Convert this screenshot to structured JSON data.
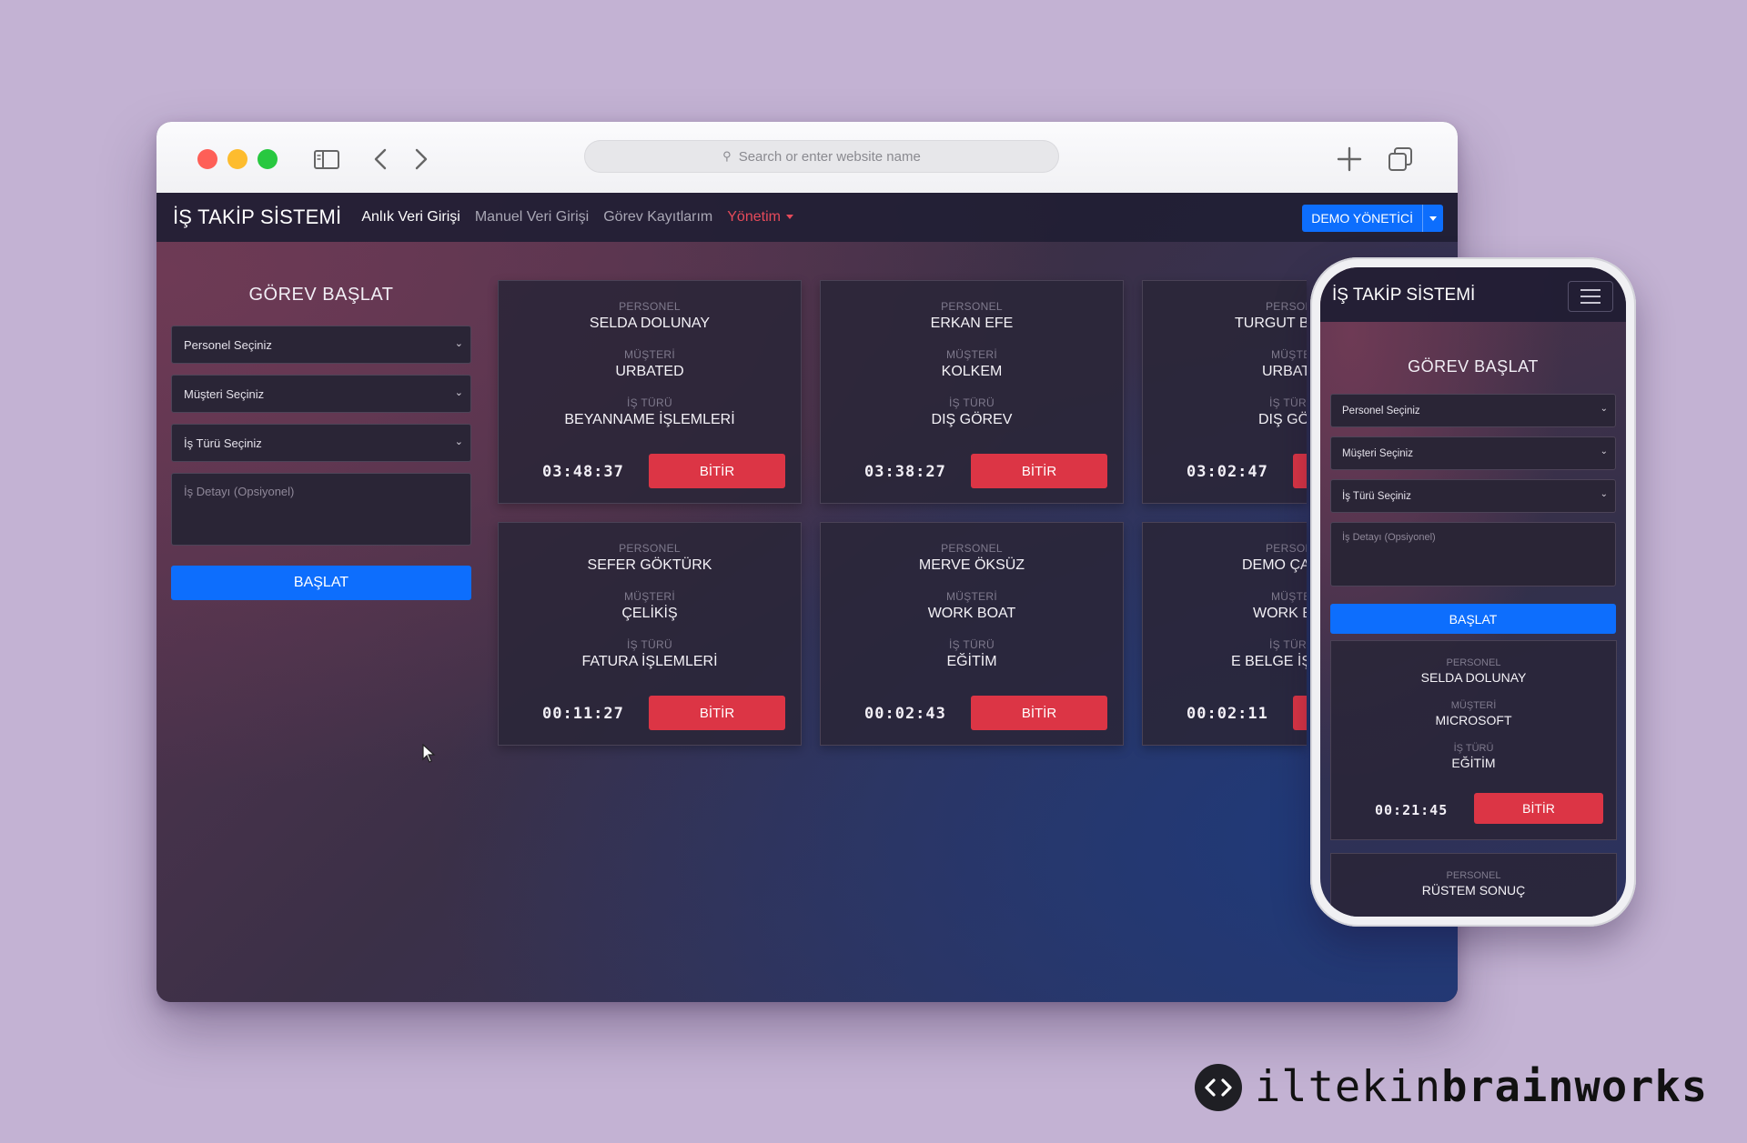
{
  "browser": {
    "url_placeholder": "Search or enter website name"
  },
  "app": {
    "brand": "İŞ TAKİP SİSTEMİ",
    "nav": [
      "Anlık Veri Girişi",
      "Manuel Veri Girişi",
      "Görev Kayıtlarım",
      "Yönetim"
    ],
    "user_button": "DEMO YÖNETİCİ",
    "form": {
      "title": "GÖREV BAŞLAT",
      "personnel_select": "Personel Seçiniz",
      "customer_select": "Müşteri Seçiniz",
      "worktype_select": "İş Türü Seçiniz",
      "detail_placeholder": "İş Detayı (Opsiyonel)",
      "start_button": "BAŞLAT"
    },
    "labels": {
      "personnel": "PERSONEL",
      "customer": "MÜŞTERİ",
      "worktype": "İŞ TÜRÜ",
      "finish": "BİTİR"
    },
    "tasks": [
      {
        "personnel": "SELDA DOLUNAY",
        "customer": "URBATED",
        "worktype": "BEYANNAME İŞLEMLERİ",
        "timer": "03:48:37"
      },
      {
        "personnel": "ERKAN EFE",
        "customer": "KOLKEM",
        "worktype": "DIŞ GÖREV",
        "timer": "03:38:27"
      },
      {
        "personnel": "TURGUT BU",
        "customer": "URBATE",
        "worktype": "DIŞ GÖR",
        "timer": "03:02:47"
      },
      {
        "personnel": "SEFER GÖKTÜRK",
        "customer": "ÇELİKİŞ",
        "worktype": "FATURA İŞLEMLERİ",
        "timer": "00:11:27"
      },
      {
        "personnel": "MERVE ÖKSÜZ",
        "customer": "WORK BOAT",
        "worktype": "EĞİTİM",
        "timer": "00:02:43"
      },
      {
        "personnel": "DEMO ÇAL",
        "customer": "WORK BO",
        "worktype": "E BELGE İŞL",
        "timer": "00:02:11"
      }
    ],
    "partial_labels": [
      "PERSON",
      "MÜŞTE",
      "İŞ TÜR"
    ]
  },
  "phone": {
    "brand": "İŞ TAKİP SİSTEMİ",
    "form": {
      "title": "GÖREV BAŞLAT",
      "personnel_select": "Personel Seçiniz",
      "customer_select": "Müşteri Seçiniz",
      "worktype_select": "İş Türü Seçiniz",
      "detail_placeholder": "İş Detayı (Opsiyonel)",
      "start_button": "BAŞLAT"
    },
    "task": {
      "personnel": "SELDA DOLUNAY",
      "customer": "MICROSOFT",
      "worktype": "EĞİTİM",
      "timer": "00:21:45"
    },
    "next_task": {
      "personnel": "RÜSTEM SONUÇ"
    }
  },
  "watermark": {
    "part1": "iltekin",
    "part2": "brainworks"
  },
  "icons": {
    "sidebar": "sidebar-toggle-icon",
    "back": "chevron-left-icon",
    "forward": "chevron-right-icon",
    "new_tab": "plus-icon",
    "tabs": "tabs-overview-icon",
    "search": "search-icon",
    "menu": "hamburger-menu-icon",
    "logo": "code-brackets-icon"
  },
  "colors": {
    "primary": "#0d6efd",
    "danger": "#dc3545",
    "admin_link": "#e64a5a",
    "page_background": "#c3b2d3"
  }
}
